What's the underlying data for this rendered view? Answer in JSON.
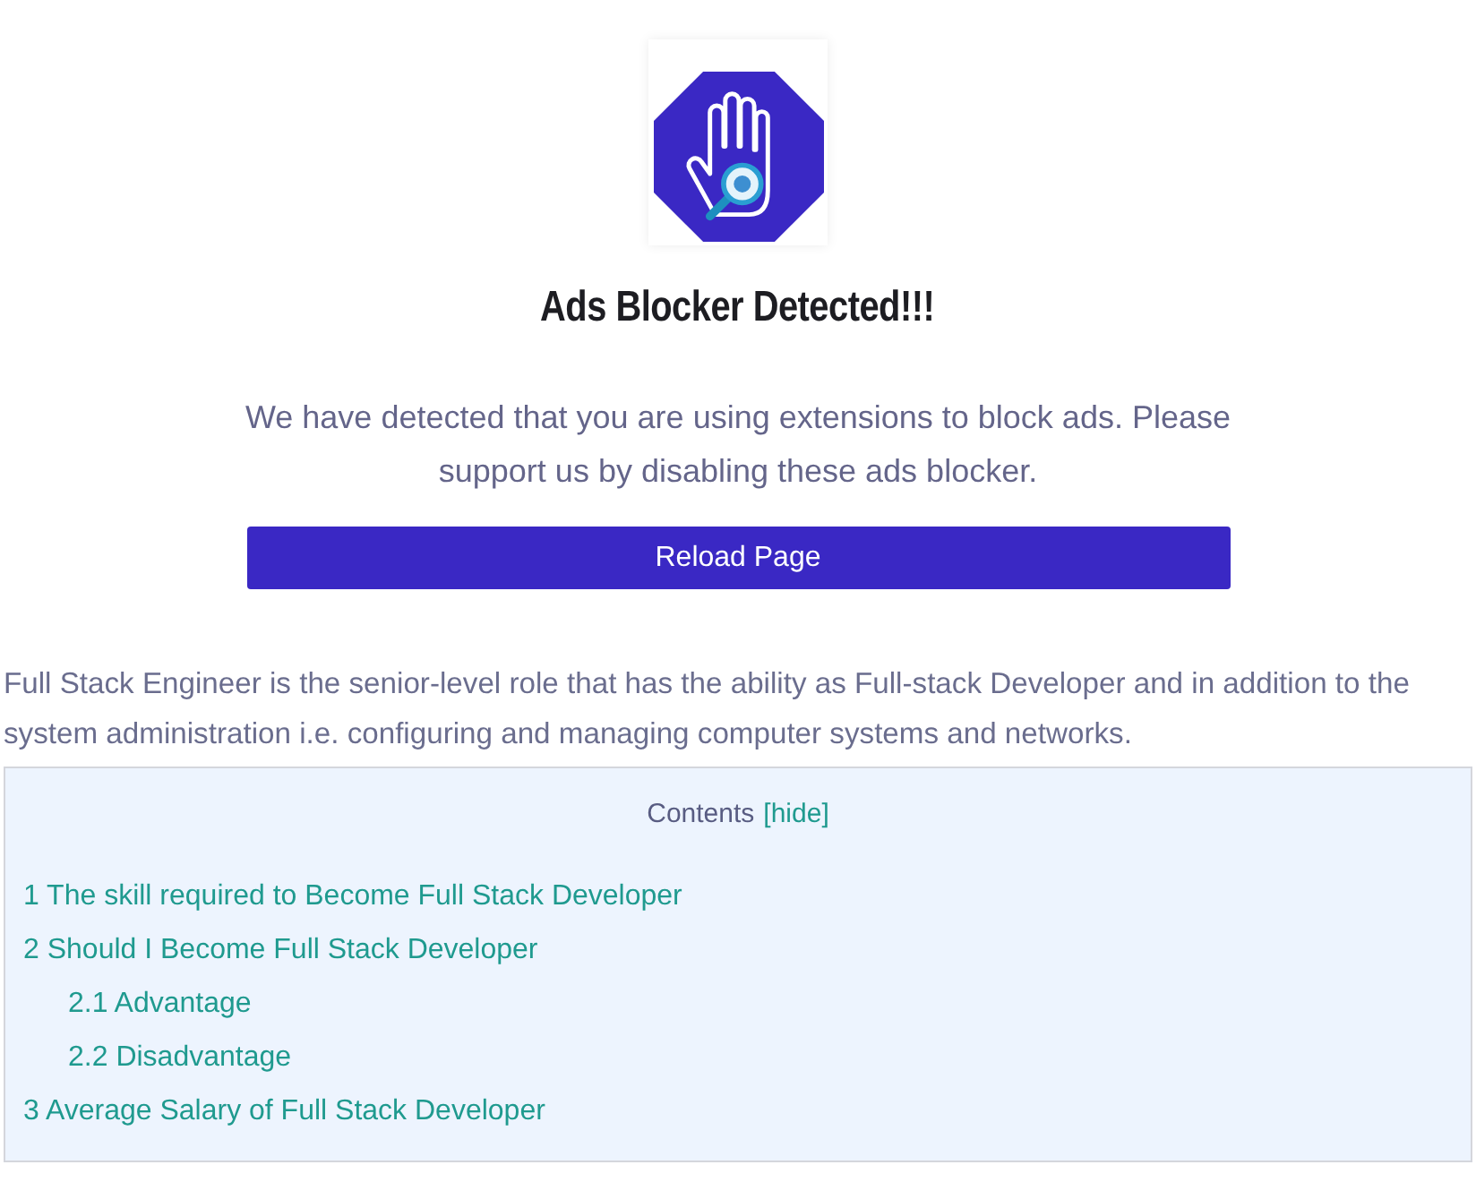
{
  "dialog": {
    "title": "Ads Blocker Detected!!!",
    "message": "We have detected that you are using extensions to block ads. Please support us by disabling these ads blocker.",
    "button": "Reload Page"
  },
  "article": {
    "intro": "Full Stack Engineer is the senior-level role that has the ability as Full-stack Developer and in addition to the system administration i.e. configuring and managing computer systems and networks.",
    "toc": {
      "title": "Contents",
      "toggle": "[hide]",
      "items": [
        {
          "label": "1 The skill required to Become Full Stack Developer"
        },
        {
          "label": "2 Should I Become Full Stack Developer",
          "children": [
            {
              "label": "2.1 Advantage"
            },
            {
              "label": "2.2 Disadvantage"
            }
          ]
        },
        {
          "label": "3 Average Salary of Full Stack Developer"
        }
      ]
    }
  }
}
